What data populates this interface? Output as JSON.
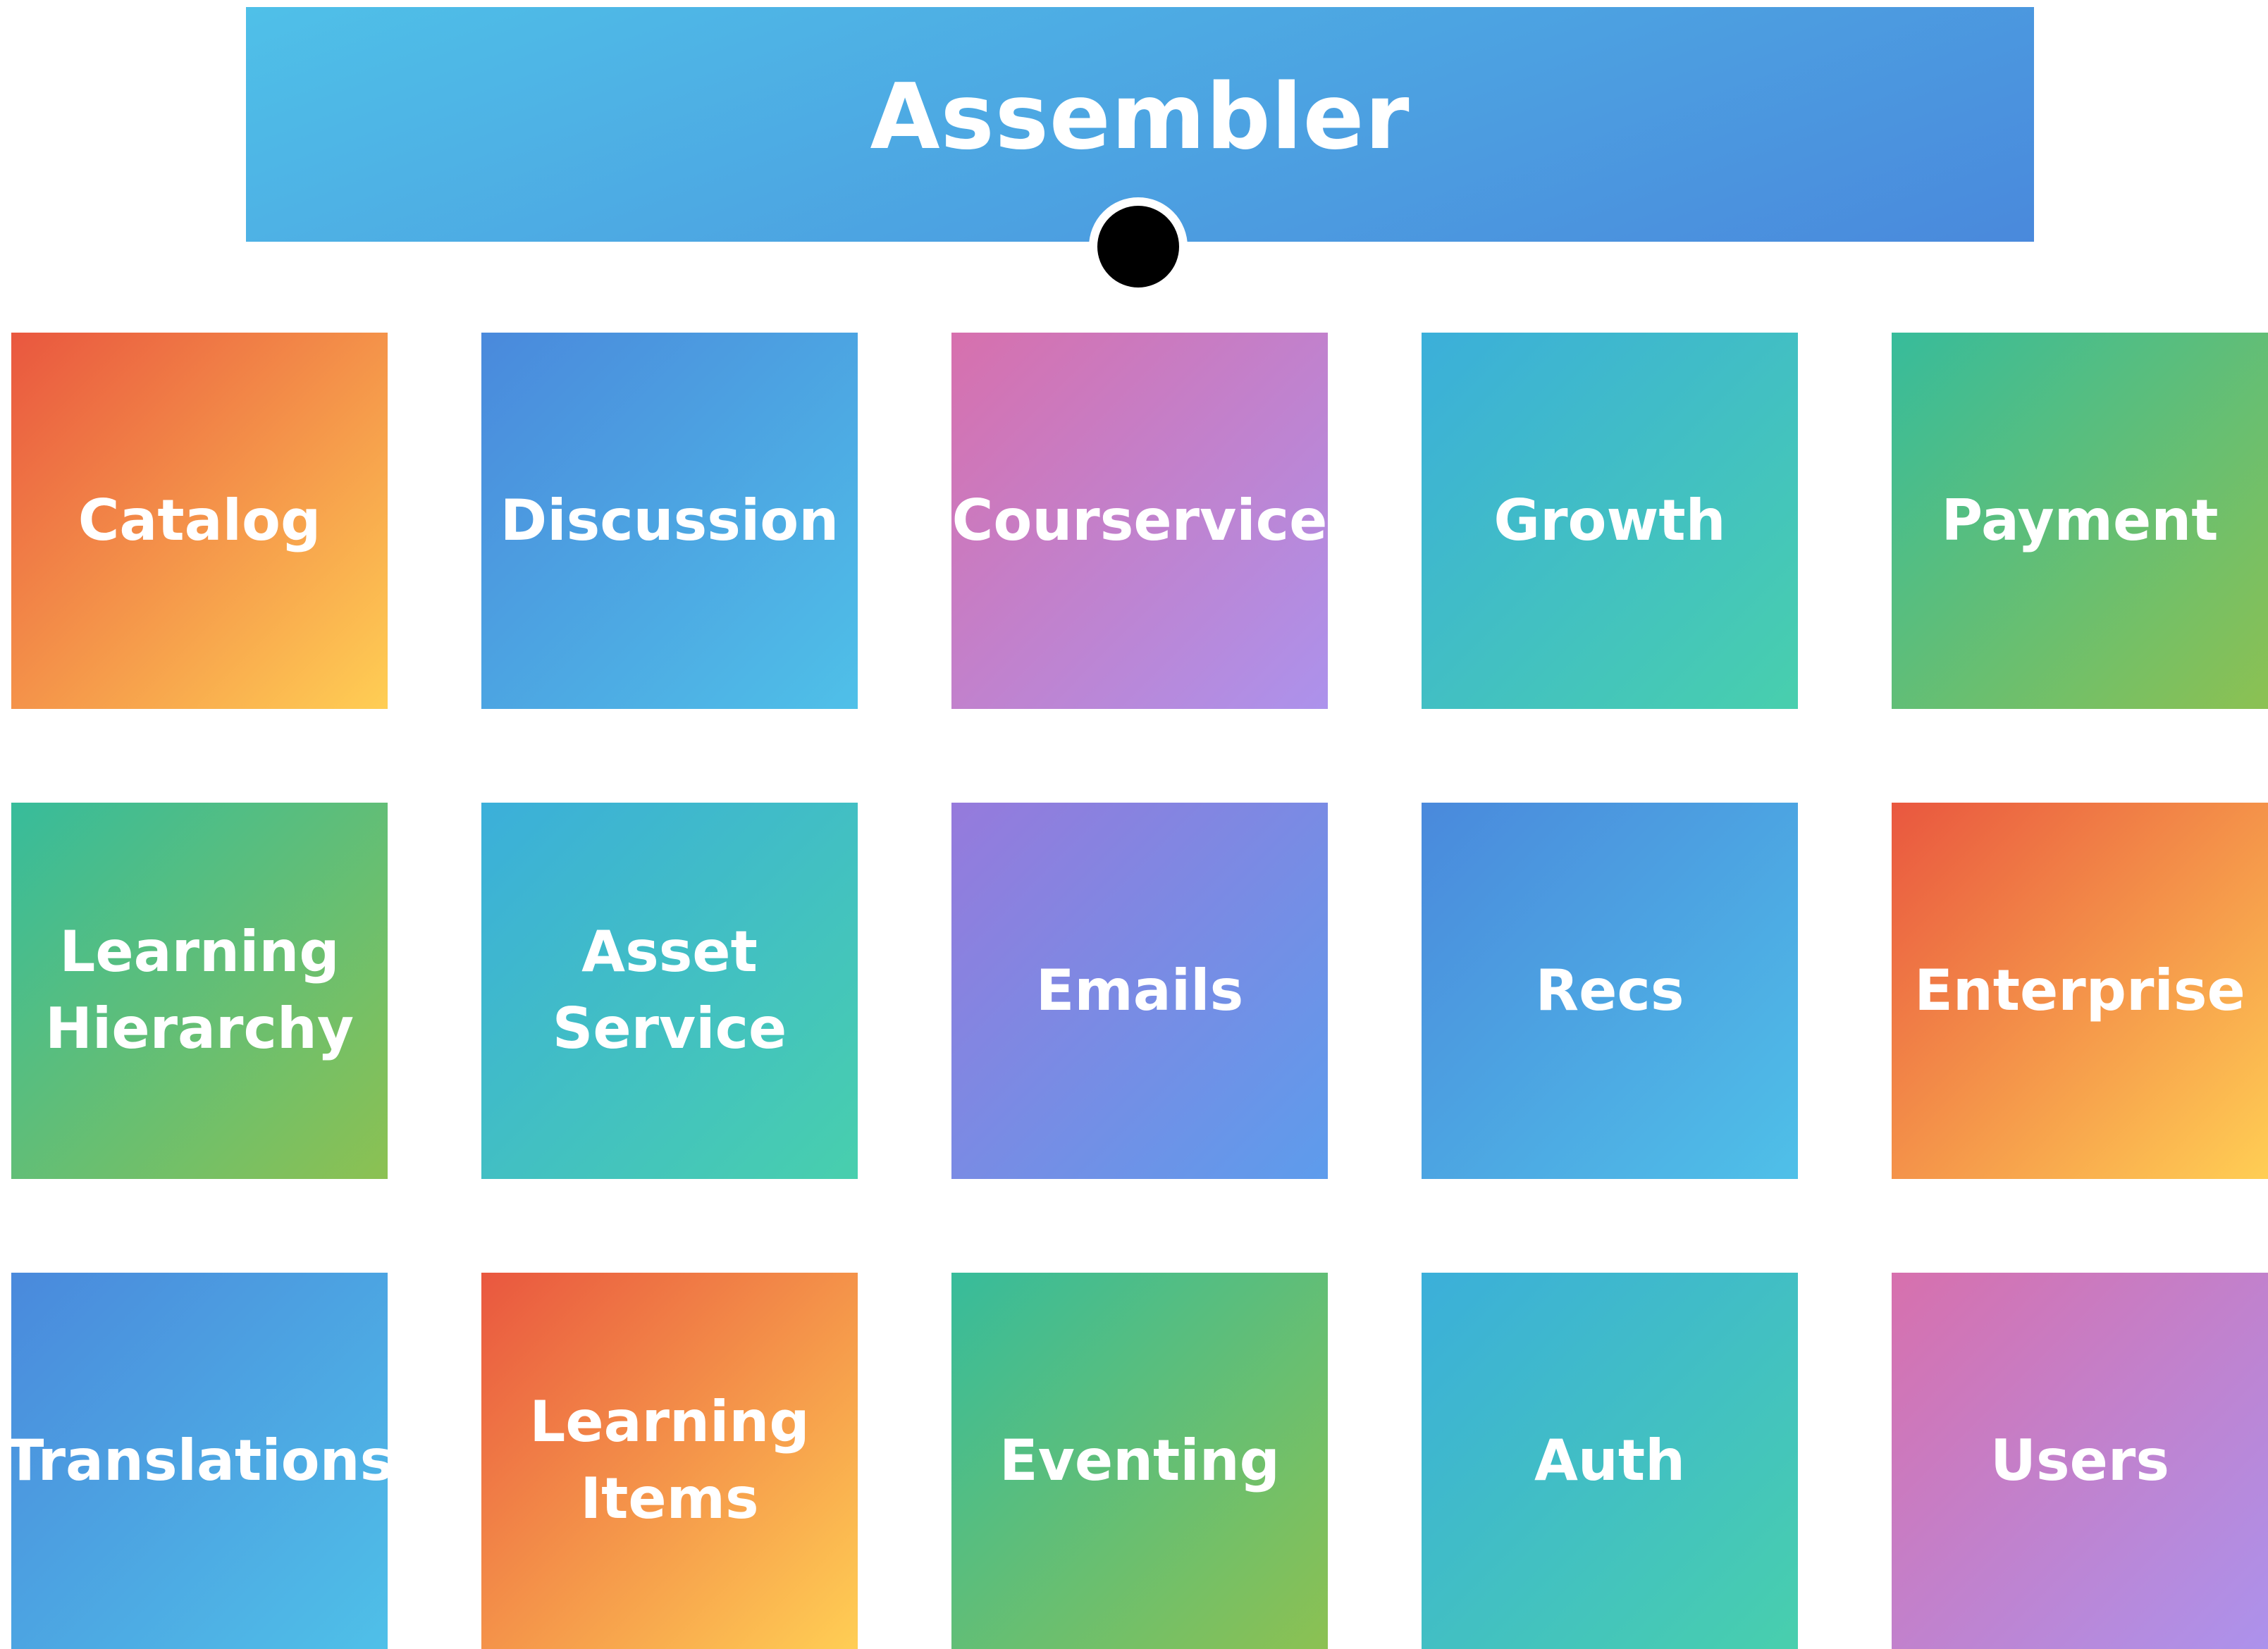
{
  "header": {
    "title": "Assembler",
    "gradient": [
      "#4fc0e8",
      "#4a89dc"
    ]
  },
  "services": [
    {
      "label": "Catalog",
      "gradient": [
        "#e9573f",
        "#ffce54"
      ]
    },
    {
      "label": "Discussion",
      "gradient": [
        "#4a89dc",
        "#4fc0e8"
      ]
    },
    {
      "label": "Courservice",
      "gradient": [
        "#d770ad",
        "#ac92ec"
      ]
    },
    {
      "label": "Growth",
      "gradient": [
        "#3bafda",
        "#48cfad"
      ]
    },
    {
      "label": "Payment",
      "gradient": [
        "#37bc9b",
        "#8cc152"
      ]
    },
    {
      "label": "Learning\nHierarchy",
      "gradient": [
        "#37bc9b",
        "#8cc152"
      ]
    },
    {
      "label": "Asset\nService",
      "gradient": [
        "#3bafda",
        "#48cfad"
      ]
    },
    {
      "label": "Emails",
      "gradient": [
        "#967adc",
        "#5d9cec"
      ]
    },
    {
      "label": "Recs",
      "gradient": [
        "#4a89dc",
        "#4fc0e8"
      ]
    },
    {
      "label": "Enterprise",
      "gradient": [
        "#e9573f",
        "#ffce54"
      ]
    },
    {
      "label": "Translations",
      "gradient": [
        "#4a89dc",
        "#4fc0e8"
      ]
    },
    {
      "label": "Learning\nItems",
      "gradient": [
        "#e9573f",
        "#ffce54"
      ]
    },
    {
      "label": "Eventing",
      "gradient": [
        "#37bc9b",
        "#8cc152"
      ]
    },
    {
      "label": "Auth",
      "gradient": [
        "#3bafda",
        "#48cfad"
      ]
    },
    {
      "label": "Users",
      "gradient": [
        "#d770ad",
        "#ac92ec"
      ]
    }
  ]
}
